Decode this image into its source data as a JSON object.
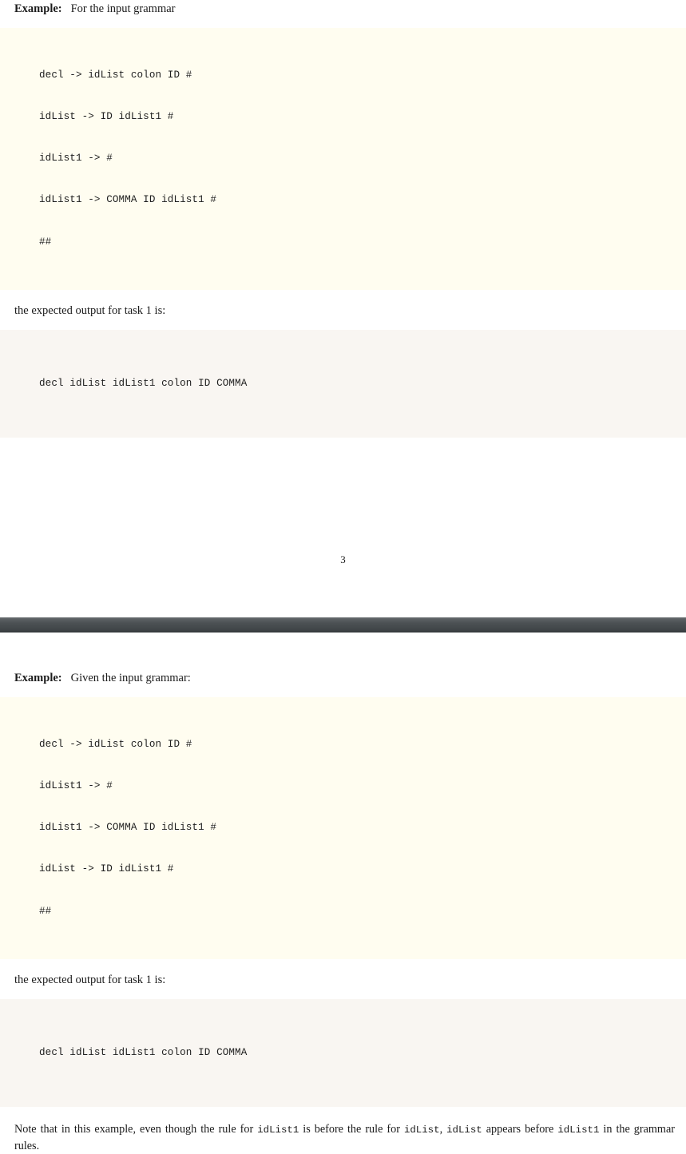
{
  "document": {
    "type": "pdf-page-view",
    "colors": {
      "page_background": "#ffffff",
      "grammar_block_background": "#fffdf0",
      "output_block_background": "#f9f6f2",
      "separator_bar": "#4c5154",
      "text": "#1b1b1b"
    }
  },
  "page_one": {
    "example": {
      "label": "Example:",
      "text": "For the input grammar"
    },
    "grammar_block": {
      "lines": [
        "decl -> idList colon ID #",
        "idList -> ID idList1 #",
        "idList1 -> #",
        "idList1 -> COMMA ID idList1 #",
        "##"
      ]
    },
    "lead_in": "the expected output for task 1 is:",
    "output_block": {
      "lines": [
        "decl idList idList1 colon ID COMMA"
      ]
    },
    "page_number": "3"
  },
  "page_two": {
    "example": {
      "label": "Example:",
      "text": "Given the input grammar:"
    },
    "grammar_block": {
      "lines": [
        "decl -> idList colon ID #",
        "idList1 -> #",
        "idList1 -> COMMA ID idList1 #",
        "idList -> ID idList1 #",
        "##"
      ]
    },
    "lead_in": "the expected output for task 1 is:",
    "output_block": {
      "lines": [
        "decl idList idList1 colon ID COMMA"
      ]
    },
    "note": {
      "part1": "Note that in this example, even though the rule for ",
      "code1": "idList1",
      "part2": " is before the rule for ",
      "code2": "idList",
      "part3": ", ",
      "code3": "idList",
      "part4": " appears before ",
      "code4": "idList1",
      "part5": " in the grammar rules."
    }
  }
}
